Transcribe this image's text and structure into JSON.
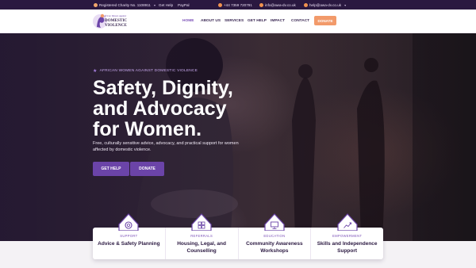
{
  "topbar": {
    "charity": "Registered Charity No. 1108911",
    "get_help": "Get Help",
    "paypal": "PayPal",
    "phone": "+44 7359 720791",
    "email_info": "info@awa-dv.co.uk",
    "email_help": "help@awa-dv.co.uk"
  },
  "logo": {
    "line1": "African Women Against",
    "line2": "DOMESTIC",
    "line3": "VIOLENCE"
  },
  "nav": {
    "items": [
      "HOME",
      "ABOUT US",
      "SERVICES",
      "GET HELP",
      "IMPACT",
      "CONTACT"
    ],
    "donate": "DONATE"
  },
  "hero": {
    "eyebrow": "AFRICAN WOMEN AGAINST DOMESTIC VIOLENCE",
    "headline_line1": "Safety, Dignity,",
    "headline_line2": "and Advocacy",
    "headline_line3": "for Women.",
    "subtext": "Free, culturally sensitive advice, advocacy, and practical support for women affected by domestic violence.",
    "btn_help": "GET HELP",
    "btn_donate": "DONATE"
  },
  "cards": [
    {
      "tag": "SUPPORT",
      "title": "Advice & Safety Planning",
      "icon": "lifebuoy-icon"
    },
    {
      "tag": "REFERRALS",
      "title": "Housing, Legal, and Counselling",
      "icon": "grid-icon"
    },
    {
      "tag": "EDUCATION",
      "title": "Community Awareness Workshops",
      "icon": "presentation-icon"
    },
    {
      "tag": "EMPOWERMENT",
      "title": "Skills and Independence Support",
      "icon": "growth-icon"
    }
  ],
  "colors": {
    "brand_purple": "#6b44a8",
    "accent_orange": "#f29a6a",
    "topbar_bg": "#2a1840"
  }
}
